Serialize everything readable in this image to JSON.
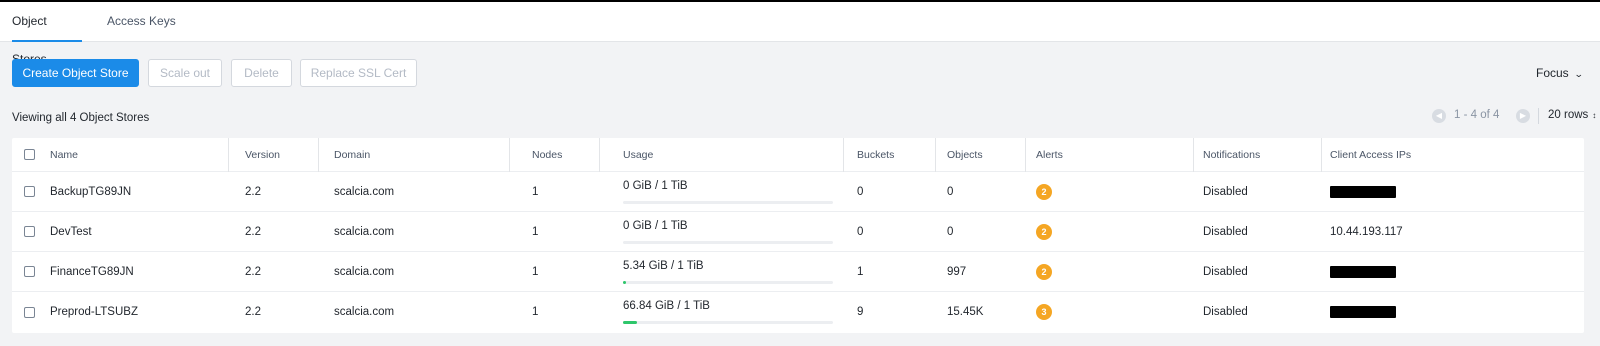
{
  "tabs": [
    {
      "label": "Object Stores",
      "active": true
    },
    {
      "label": "Access Keys",
      "active": false
    }
  ],
  "toolbar": {
    "create": "Create Object Store",
    "scale_out": "Scale out",
    "delete": "Delete",
    "replace_ssl": "Replace SSL Cert",
    "focus": "Focus"
  },
  "summary": "Viewing all 4 Object Stores",
  "pagination": {
    "range": "1 - 4 of 4",
    "rows": "20 rows"
  },
  "columns": [
    "Name",
    "Version",
    "Domain",
    "Nodes",
    "Usage",
    "Buckets",
    "Objects",
    "Alerts",
    "Notifications",
    "Client Access IPs"
  ],
  "rows": [
    {
      "name": "BackupTG89JN",
      "version": "2.2",
      "domain": "scalcia.com",
      "nodes": "1",
      "usage": "0 GiB / 1 TiB",
      "usage_fraction": 0.0,
      "buckets": "0",
      "objects": "0",
      "alerts": "2",
      "notifications": "Disabled",
      "client_ips": "",
      "client_ips_redacted": true
    },
    {
      "name": "DevTest",
      "version": "2.2",
      "domain": "scalcia.com",
      "nodes": "1",
      "usage": "0 GiB / 1 TiB",
      "usage_fraction": 0.0,
      "buckets": "0",
      "objects": "0",
      "alerts": "2",
      "notifications": "Disabled",
      "client_ips": "10.44.193.117",
      "client_ips_redacted": false
    },
    {
      "name": "FinanceTG89JN",
      "version": "2.2",
      "domain": "scalcia.com",
      "nodes": "1",
      "usage": "5.34 GiB / 1 TiB",
      "usage_fraction": 0.0052,
      "buckets": "1",
      "objects": "997",
      "alerts": "2",
      "notifications": "Disabled",
      "client_ips": "",
      "client_ips_redacted": true
    },
    {
      "name": "Preprod-LTSUBZ",
      "version": "2.2",
      "domain": "scalcia.com",
      "nodes": "1",
      "usage": "66.84 GiB / 1 TiB",
      "usage_fraction": 0.0653,
      "buckets": "9",
      "objects": "15.45K",
      "alerts": "3",
      "notifications": "Disabled",
      "client_ips": "",
      "client_ips_redacted": true
    }
  ],
  "colors": {
    "primary": "#1b8be8",
    "alert": "#f5a623",
    "usage_bar": "#2ec66b"
  }
}
